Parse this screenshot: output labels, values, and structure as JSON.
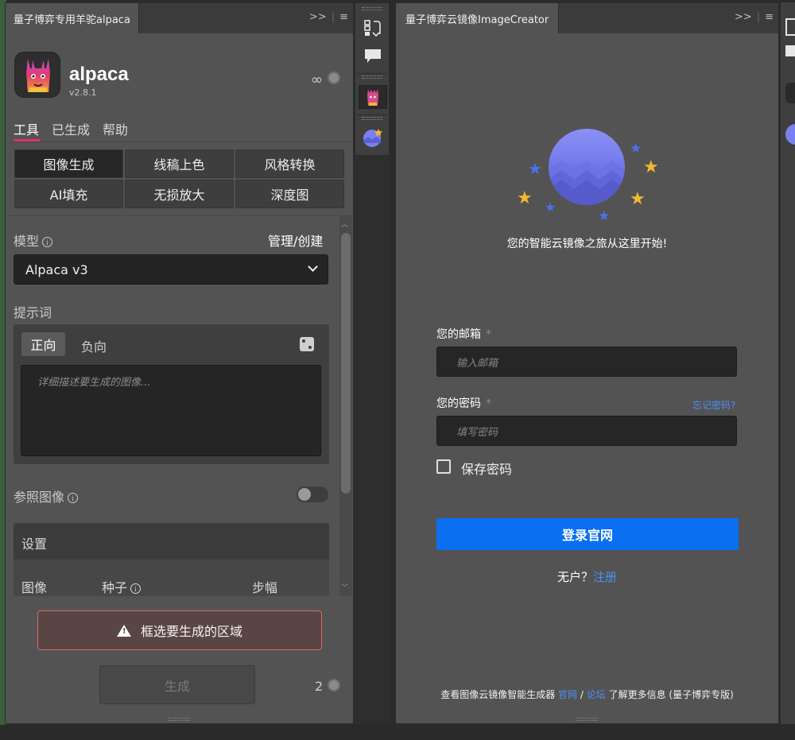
{
  "panel_alpaca": {
    "tab_title": "量子博弈专用羊驼alpaca",
    "header_controls": {
      "collapse": ">>",
      "menu": "≡"
    },
    "app_name": "alpaca",
    "version": "v2.8.1",
    "infinity": "∞",
    "nav_tabs": [
      "工具",
      "已生成",
      "帮助"
    ],
    "tools": [
      "图像生成",
      "线稿上色",
      "风格转换",
      "AI填充",
      "无损放大",
      "深度图"
    ],
    "model_label": "模型",
    "manage_label": "管理/创建",
    "model_value": "Alpaca v3",
    "prompt_label": "提示词",
    "prompt_tabs": {
      "positive": "正向",
      "negative": "负向"
    },
    "prompt_placeholder": "详细描述要生成的图像...",
    "ref_image_label": "参照图像",
    "settings_title": "设置",
    "settings_cols": [
      "图像",
      "种子",
      "步幅"
    ],
    "warning_text": "框选要生成的区域",
    "generate_label": "生成",
    "generate_count": "2"
  },
  "panel_creator": {
    "tab_title": "量子博弈云镜像ImageCreator",
    "header_controls": {
      "collapse": ">>",
      "menu": "≡"
    },
    "tagline": "您的智能云镜像之旅从这里开始!",
    "email_label": "您的邮箱",
    "email_placeholder": "输入邮箱",
    "password_label": "您的密码",
    "password_placeholder": "填写密码",
    "required_mark": "*",
    "forgot_link": "忘记密码?",
    "remember_label": "保存密码",
    "login_button": "登录官网",
    "no_account_prefix": "无户？",
    "register_link": "注册",
    "footer_prefix": "查看图像云镜像智能生成器",
    "footer_link1": "官网",
    "footer_sep": "/",
    "footer_link2": "论坛",
    "footer_suffix": "了解更多信息 (量子博弈专版)"
  },
  "colors": {
    "accent_pink": "#e0336d",
    "link_blue": "#4d8ff5",
    "login_blue": "#0a6ff0",
    "warning_border": "#e06666"
  }
}
